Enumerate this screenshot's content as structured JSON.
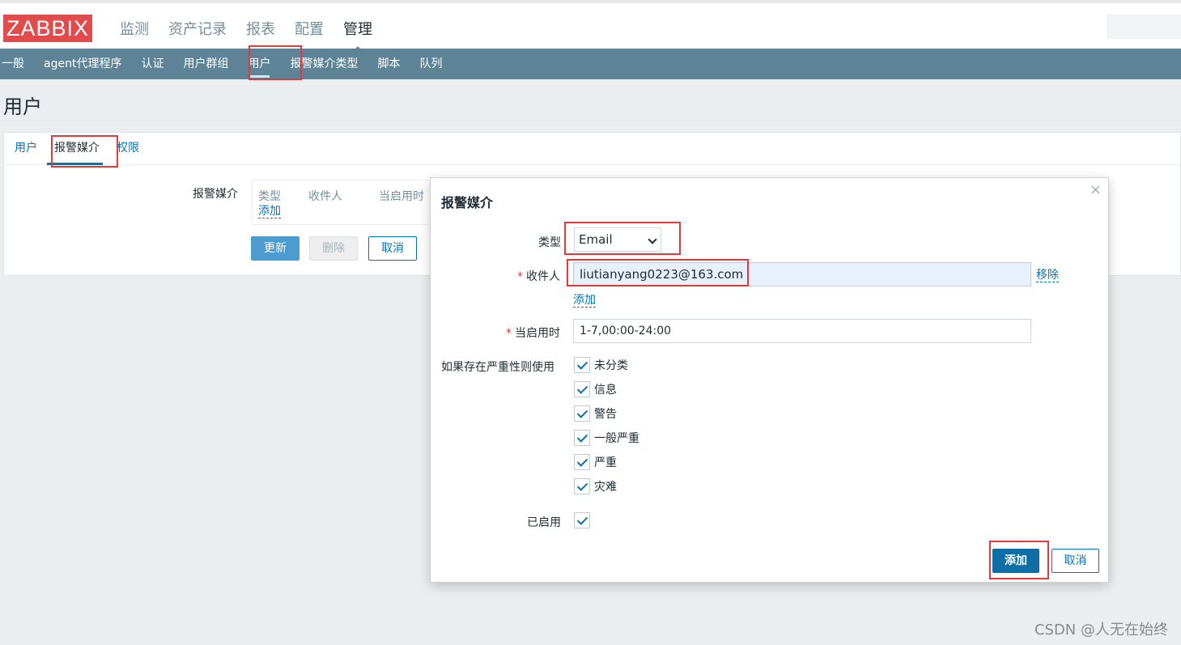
{
  "logo": "ZABBIX",
  "main_menu": [
    "监测",
    "资产记录",
    "报表",
    "配置",
    "管理"
  ],
  "sub_menu": [
    "一般",
    "agent代理程序",
    "认证",
    "用户群组",
    "用户",
    "报警媒介类型",
    "脚本",
    "队列"
  ],
  "page_title": "用户",
  "tabs": [
    "用户",
    "报警媒介",
    "权限"
  ],
  "media_form": {
    "label": "报警媒介",
    "columns": [
      "类型",
      "收件人",
      "当启用时"
    ],
    "add_link": "添加"
  },
  "buttons": {
    "update": "更新",
    "delete": "删除",
    "cancel": "取消"
  },
  "dialog": {
    "title": "报警媒介",
    "close": "×",
    "type_label": "类型",
    "type_value": "Email",
    "sendto_label": "收件人",
    "sendto_value": "liutianyang0223@163.com",
    "remove_link": "移除",
    "add_link": "添加",
    "period_label": "当启用时",
    "period_value": "1-7,00:00-24:00",
    "severity_label": "如果存在严重性则使用",
    "severities": [
      "未分类",
      "信息",
      "警告",
      "一般严重",
      "严重",
      "灾难"
    ],
    "enabled_label": "已启用",
    "add_button": "添加",
    "cancel_button": "取消"
  },
  "watermark": "CSDN @人无在始终"
}
